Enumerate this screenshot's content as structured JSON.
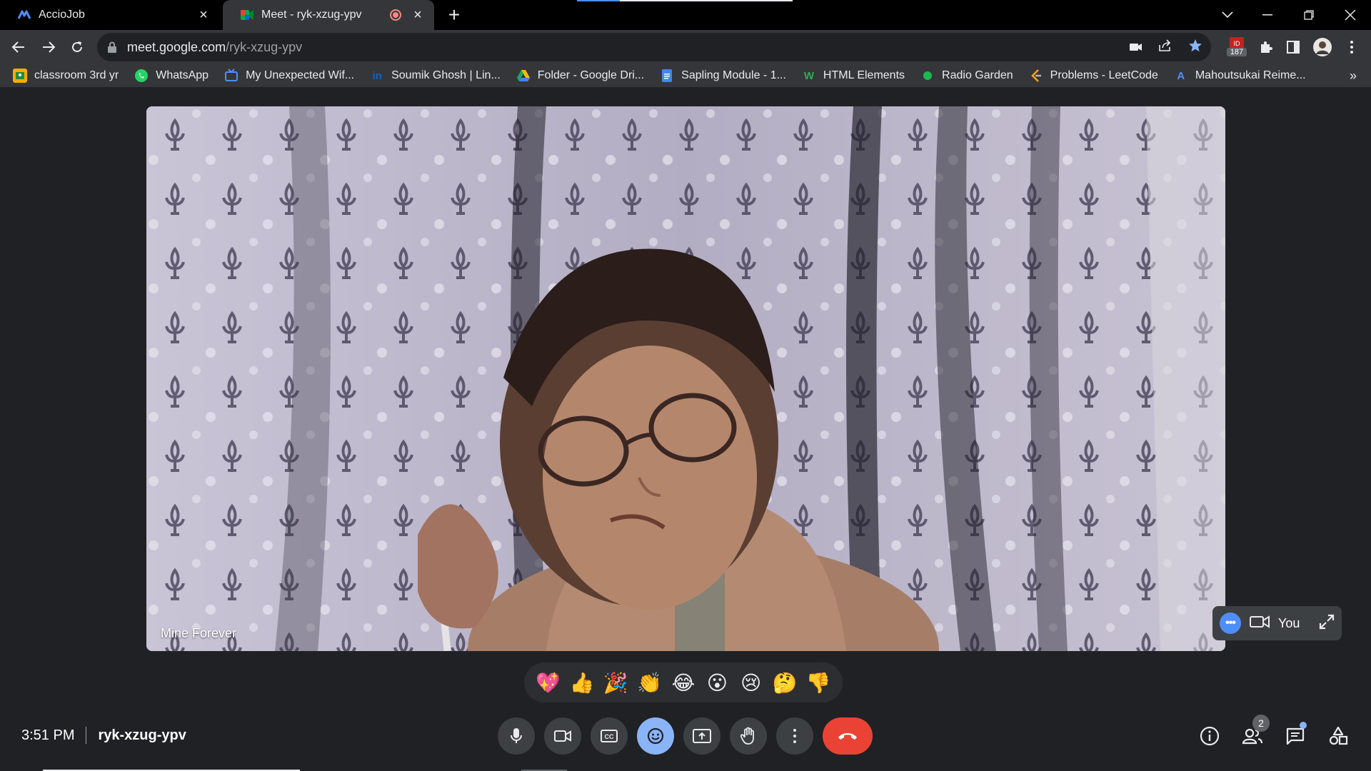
{
  "browser": {
    "tabs": [
      {
        "title": "AccioJob",
        "active": false
      },
      {
        "title": "Meet - ryk-xzug-ypv",
        "active": true
      }
    ],
    "url_host": "meet.google.com",
    "url_path": "/ryk-xzug-ypv",
    "extension_badge": "187",
    "bookmarks": [
      {
        "label": "classroom 3rd yr",
        "icon": "classroom-icon",
        "color": "#f9ab00"
      },
      {
        "label": "WhatsApp",
        "icon": "whatsapp-icon",
        "color": "#25d366"
      },
      {
        "label": "My Unexpected Wif...",
        "icon": "tv-icon",
        "color": "#4f8ef7"
      },
      {
        "label": "Soumik Ghosh | Lin...",
        "icon": "linkedin-icon",
        "color": "#0a66c2"
      },
      {
        "label": "Folder - Google Dri...",
        "icon": "drive-icon",
        "color": "#fbbc04"
      },
      {
        "label": "Sapling Module - 1...",
        "icon": "docs-icon",
        "color": "#4285f4"
      },
      {
        "label": "HTML Elements",
        "icon": "w-icon",
        "color": "#34a853"
      },
      {
        "label": "Radio Garden",
        "icon": "radio-dot-icon",
        "color": "#1db954"
      },
      {
        "label": "Problems - LeetCode",
        "icon": "leetcode-icon",
        "color": "#ffa116"
      },
      {
        "label": "Mahoutsukai Reime...",
        "icon": "anime-icon",
        "color": "#2e51a2"
      }
    ]
  },
  "meet": {
    "participant_name": "Mine Forever",
    "self_label": "You",
    "reactions": [
      "💖",
      "👍",
      "🎉",
      "👏",
      "😂",
      "😮",
      "😢",
      "🤔",
      "👎"
    ],
    "time": "3:51 PM",
    "meeting_code": "ryk-xzug-ypv",
    "participant_count": "2"
  }
}
